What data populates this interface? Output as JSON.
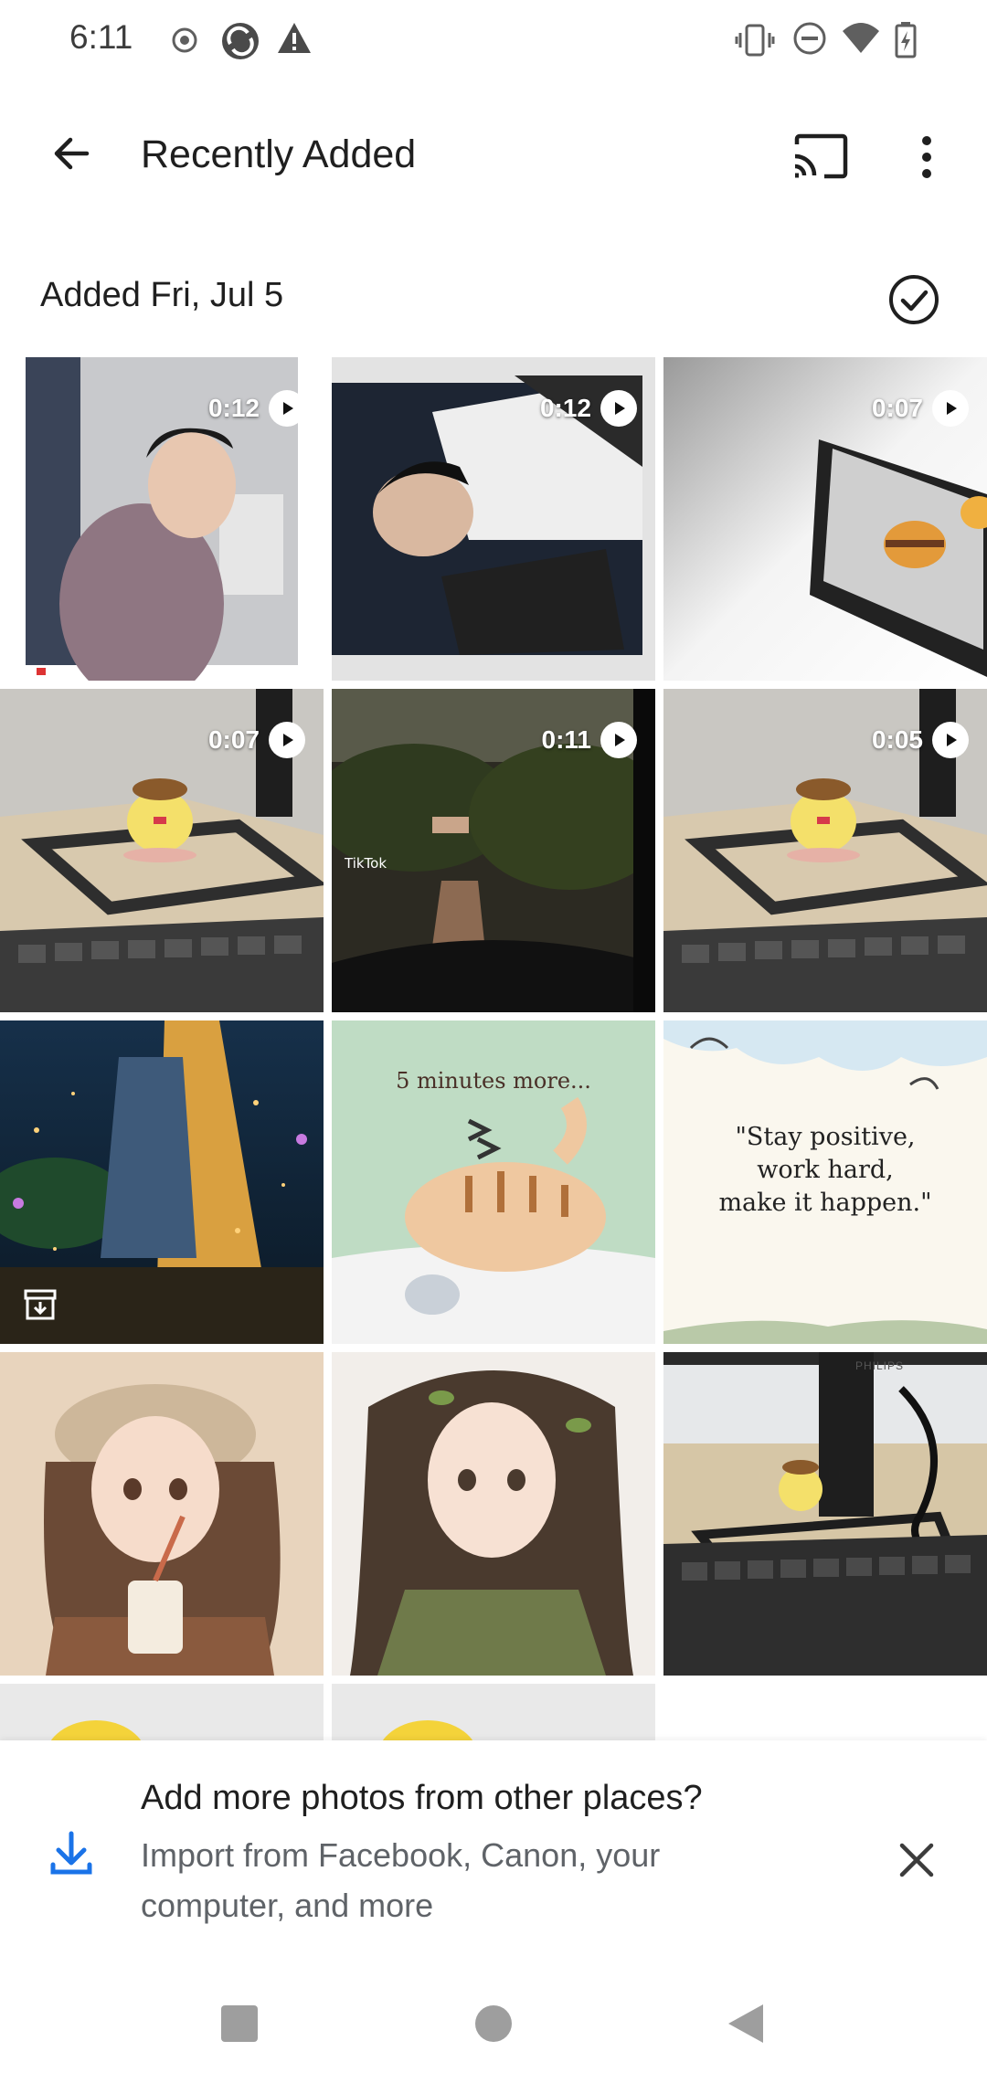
{
  "status_bar": {
    "time": "6:11",
    "left_icons": [
      "record-icon",
      "sync-icon",
      "warning-icon"
    ],
    "right_icons": [
      "vibrate-icon",
      "do-not-disturb-icon",
      "wifi-icon",
      "battery-charging-icon"
    ]
  },
  "app_bar": {
    "title": "Recently Added",
    "back_icon": "arrow-back-icon",
    "cast_icon": "cast-icon",
    "more_icon": "more-vert-icon"
  },
  "section": {
    "title": "Added Fri, Jul 5",
    "select_icon": "check-circle-icon"
  },
  "grid": [
    {
      "kind": "video",
      "duration": "0:12",
      "subject": "person in jacket"
    },
    {
      "kind": "video",
      "duration": "0:12",
      "subject": "person in varsity jacket"
    },
    {
      "kind": "video",
      "duration": "0:07",
      "subject": "burger toy"
    },
    {
      "kind": "video",
      "duration": "0:07",
      "subject": "yellow plush on desk"
    },
    {
      "kind": "video",
      "duration": "0:11",
      "subject": "tiktok village view",
      "watermark": "TikTok"
    },
    {
      "kind": "video",
      "duration": "0:05",
      "subject": "yellow plush on desk"
    },
    {
      "kind": "photo",
      "subject": "fantasy illustration",
      "archived": true
    },
    {
      "kind": "photo",
      "subject": "sleeping cat",
      "caption": "5 minutes more..."
    },
    {
      "kind": "photo",
      "subject": "quote card",
      "caption_lines": [
        "\"Stay positive,",
        "work hard,",
        "make it happen.\""
      ]
    },
    {
      "kind": "photo",
      "subject": "girl with drink illustration"
    },
    {
      "kind": "photo",
      "subject": "girl with leaves illustration"
    },
    {
      "kind": "photo",
      "subject": "desk with keyboard",
      "monitor_label": "PHILIPS"
    }
  ],
  "banner": {
    "title": "Add more photos from other places?",
    "body": "Import from Facebook, Canon, your computer, and more",
    "download_icon": "download-icon",
    "close_icon": "close-icon",
    "accent_color": "#1a73e8"
  },
  "nav_bar": {
    "icons": [
      "recents-square-icon",
      "home-circle-icon",
      "back-triangle-icon"
    ]
  }
}
